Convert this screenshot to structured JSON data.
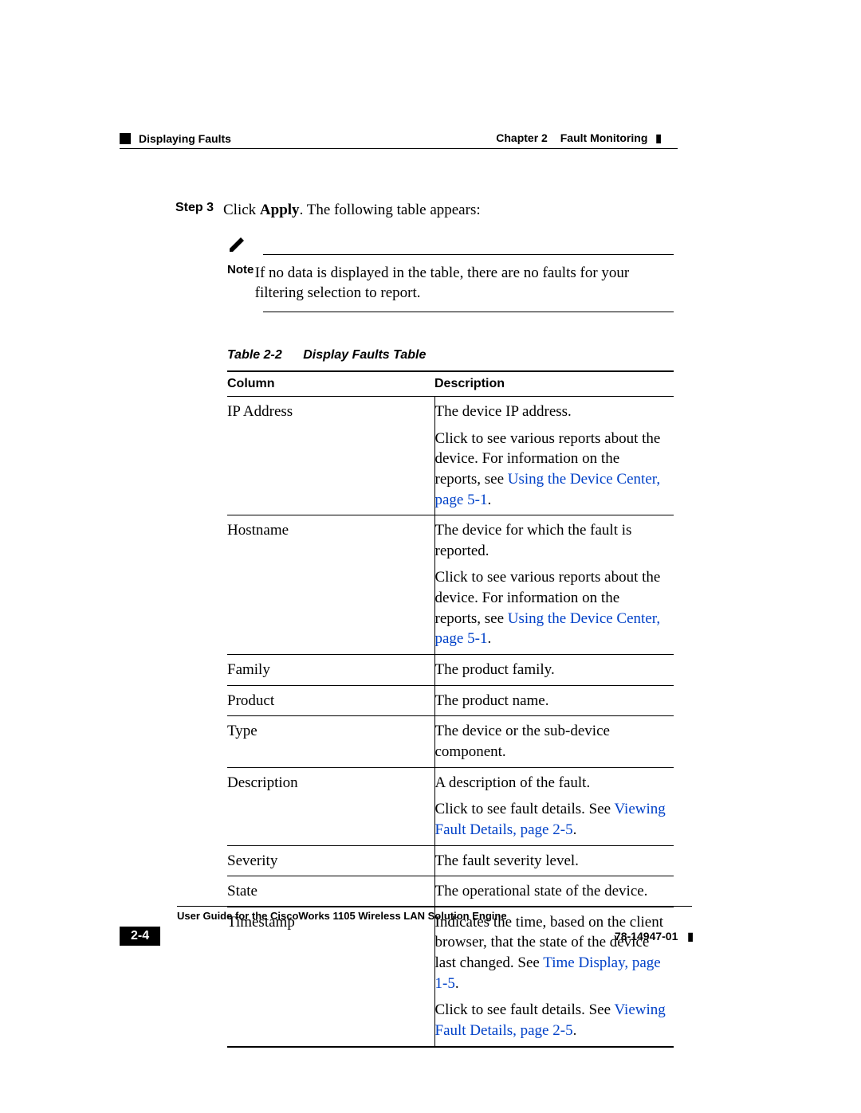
{
  "header": {
    "section": "Displaying Faults",
    "chapter_label": "Chapter 2",
    "chapter_title": "Fault Monitoring"
  },
  "step": {
    "label": "Step 3",
    "text_pre": "Click ",
    "text_bold": "Apply",
    "text_post": ". The following table appears:"
  },
  "note": {
    "label": "Note",
    "text": "If no data is displayed in the table, there are no faults for your filtering selection to report."
  },
  "table": {
    "caption_id": "Table 2-2",
    "caption_title": "Display Faults Table",
    "head_col1": "Column",
    "head_col2": "Description",
    "rows": [
      {
        "column": "IP Address",
        "desc": [
          {
            "text": "The device IP address."
          },
          {
            "text": "Click to see various reports about the device. For information on the reports, see ",
            "xref": "Using the Device Center, page 5-1",
            "after": "."
          }
        ]
      },
      {
        "column": "Hostname",
        "desc": [
          {
            "text": "The device for which the fault is reported."
          },
          {
            "text": "Click to see various reports about the device. For information on the reports, see ",
            "xref": "Using the Device Center, page 5-1",
            "after": "."
          }
        ]
      },
      {
        "column": "Family",
        "desc": [
          {
            "text": "The product family."
          }
        ]
      },
      {
        "column": "Product",
        "desc": [
          {
            "text": "The product name."
          }
        ]
      },
      {
        "column": "Type",
        "desc": [
          {
            "text": "The device or the sub-device component."
          }
        ]
      },
      {
        "column": "Description",
        "desc": [
          {
            "text": "A description of the fault."
          },
          {
            "text": "Click to see fault details. See ",
            "xref": "Viewing Fault Details, page 2-5",
            "after": "."
          }
        ]
      },
      {
        "column": "Severity",
        "desc": [
          {
            "text": "The fault severity level."
          }
        ]
      },
      {
        "column": "State",
        "desc": [
          {
            "text": "The operational state of the device."
          }
        ]
      },
      {
        "column": "Timestamp",
        "desc": [
          {
            "text": "Indicates the time, based on the client browser, that the state of the device last changed. See ",
            "xref": "Time Display, page 1-5",
            "after": "."
          },
          {
            "text": "Click to see fault details. See ",
            "xref": "Viewing Fault Details, page 2-5",
            "after": "."
          }
        ]
      }
    ]
  },
  "footer": {
    "guide_title": "User Guide for the CiscoWorks 1105 Wireless LAN Solution Engine",
    "page_number": "2-4",
    "doc_number": "78-14947-01"
  }
}
